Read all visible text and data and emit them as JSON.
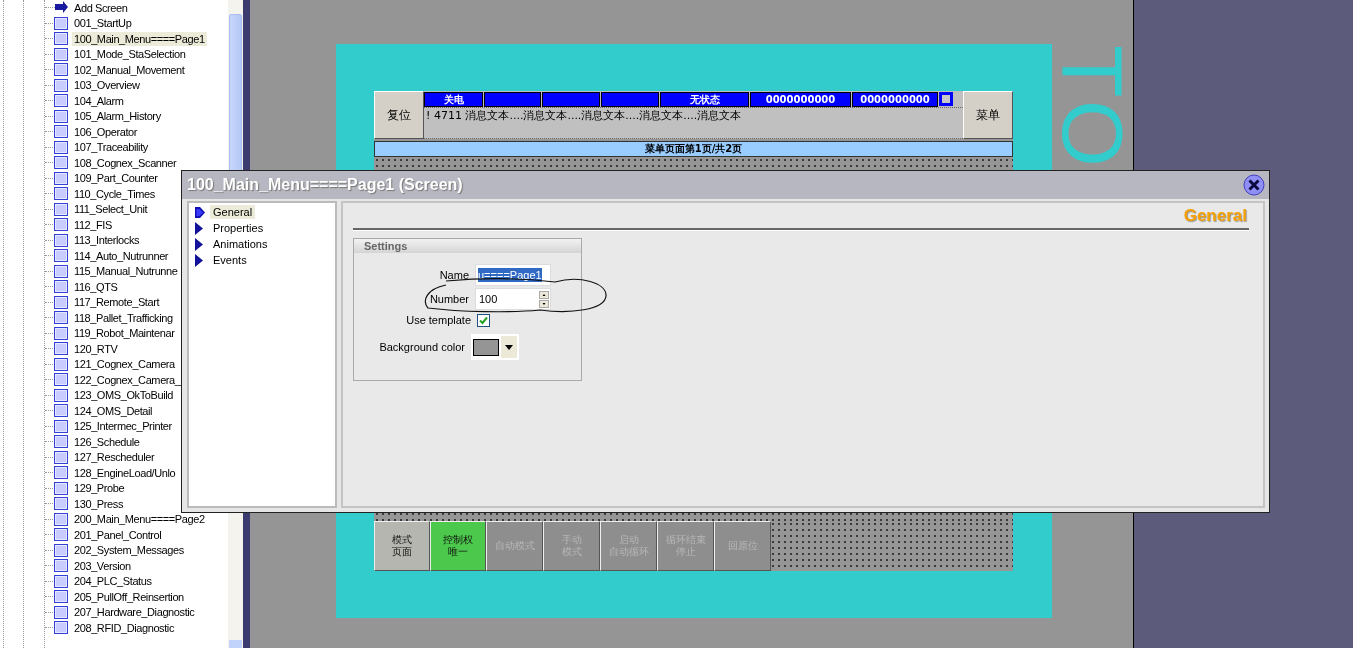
{
  "screen_tree": {
    "items": [
      {
        "kind": "add",
        "label": "Add Screen",
        "selected": false
      },
      {
        "kind": "screen",
        "label": "001_StartUp",
        "selected": false
      },
      {
        "kind": "screen",
        "label": "100_Main_Menu====Page1",
        "selected": true
      },
      {
        "kind": "screen",
        "label": "101_Mode_StaSelection",
        "selected": false
      },
      {
        "kind": "screen",
        "label": "102_Manual_Movement",
        "selected": false
      },
      {
        "kind": "screen",
        "label": "103_Overview",
        "selected": false
      },
      {
        "kind": "screen",
        "label": "104_Alarm",
        "selected": false
      },
      {
        "kind": "screen",
        "label": "105_Alarm_History",
        "selected": false
      },
      {
        "kind": "screen",
        "label": "106_Operator",
        "selected": false
      },
      {
        "kind": "screen",
        "label": "107_Traceability",
        "selected": false
      },
      {
        "kind": "screen",
        "label": "108_Cognex_Scanner",
        "selected": false
      },
      {
        "kind": "screen",
        "label": "109_Part_Counter",
        "selected": false
      },
      {
        "kind": "screen",
        "label": "110_Cycle_Times",
        "selected": false
      },
      {
        "kind": "screen",
        "label": "111_Select_Unit",
        "selected": false
      },
      {
        "kind": "screen",
        "label": "112_FIS",
        "selected": false
      },
      {
        "kind": "screen",
        "label": "113_Interlocks",
        "selected": false
      },
      {
        "kind": "screen",
        "label": "114_Auto_Nutrunner",
        "selected": false
      },
      {
        "kind": "screen",
        "label": "115_Manual_Nutrunne",
        "selected": false
      },
      {
        "kind": "screen",
        "label": "116_QTS",
        "selected": false
      },
      {
        "kind": "screen",
        "label": "117_Remote_Start",
        "selected": false
      },
      {
        "kind": "screen",
        "label": "118_Pallet_Trafficking",
        "selected": false
      },
      {
        "kind": "screen",
        "label": "119_Robot_Maintenar",
        "selected": false
      },
      {
        "kind": "screen",
        "label": "120_RTV",
        "selected": false
      },
      {
        "kind": "screen",
        "label": "121_Cognex_Camera",
        "selected": false
      },
      {
        "kind": "screen",
        "label": "122_Cognex_Camera_",
        "selected": false
      },
      {
        "kind": "screen",
        "label": "123_OMS_OkToBuild",
        "selected": false
      },
      {
        "kind": "screen",
        "label": "124_OMS_Detail",
        "selected": false
      },
      {
        "kind": "screen",
        "label": "125_Intermec_Printer",
        "selected": false
      },
      {
        "kind": "screen",
        "label": "126_Schedule",
        "selected": false
      },
      {
        "kind": "screen",
        "label": "127_Rescheduler",
        "selected": false
      },
      {
        "kind": "screen",
        "label": "128_EngineLoad/Unlo",
        "selected": false
      },
      {
        "kind": "screen",
        "label": "129_Probe",
        "selected": false
      },
      {
        "kind": "screen",
        "label": "130_Press",
        "selected": false
      },
      {
        "kind": "screen",
        "label": "200_Main_Menu====Page2",
        "selected": false
      },
      {
        "kind": "screen",
        "label": "201_Panel_Control",
        "selected": false
      },
      {
        "kind": "screen",
        "label": "202_System_Messages",
        "selected": false
      },
      {
        "kind": "screen",
        "label": "203_Version",
        "selected": false
      },
      {
        "kind": "screen",
        "label": "204_PLC_Status",
        "selected": false
      },
      {
        "kind": "screen",
        "label": "205_PullOff_Reinsertion",
        "selected": false
      },
      {
        "kind": "screen",
        "label": "207_Hardware_Diagnostic",
        "selected": false
      },
      {
        "kind": "screen",
        "label": "208_RFID_Diagnostic",
        "selected": false
      }
    ]
  },
  "hmi_screen": {
    "side_text": "TO",
    "reset_button": "复位",
    "menu_button": "菜单",
    "status_cells": [
      {
        "text": "关电"
      },
      {},
      {},
      {},
      {
        "text": "无状态"
      },
      {
        "text": "0000000000"
      },
      {
        "text": "0000000000"
      }
    ],
    "message_line": "! 4711 消息文本....消息文本....消息文本....消息文本....消息文本",
    "page_title": "菜单页面第1页/共2页",
    "bottom_buttons": [
      {
        "lines": [
          "模式",
          "页面"
        ],
        "active": false,
        "disabled": false
      },
      {
        "lines": [
          "控制权",
          "唯一"
        ],
        "active": true,
        "disabled": false
      },
      {
        "lines": [
          "自动模式"
        ],
        "active": false,
        "disabled": true
      },
      {
        "lines": [
          "手动",
          "模式"
        ],
        "active": false,
        "disabled": true
      },
      {
        "lines": [
          "启动",
          "自动循环"
        ],
        "active": false,
        "disabled": true
      },
      {
        "lines": [
          "循环结束",
          "停止"
        ],
        "active": false,
        "disabled": true
      },
      {
        "lines": [
          "回原位"
        ],
        "active": false,
        "disabled": true
      }
    ]
  },
  "dialog": {
    "title": "100_Main_Menu====Page1 (Screen)",
    "nav_items": [
      {
        "label": "General",
        "selected": true
      },
      {
        "label": "Properties",
        "selected": false
      },
      {
        "label": "Animations",
        "selected": false
      },
      {
        "label": "Events",
        "selected": false
      }
    ],
    "heading": "General",
    "group_title": "Settings",
    "name_label": "Name",
    "name_value": "u====Page1",
    "number_label": "Number",
    "number_value": "100",
    "template_label": "Use template",
    "use_template": true,
    "bgcolor_label": "Background color"
  }
}
